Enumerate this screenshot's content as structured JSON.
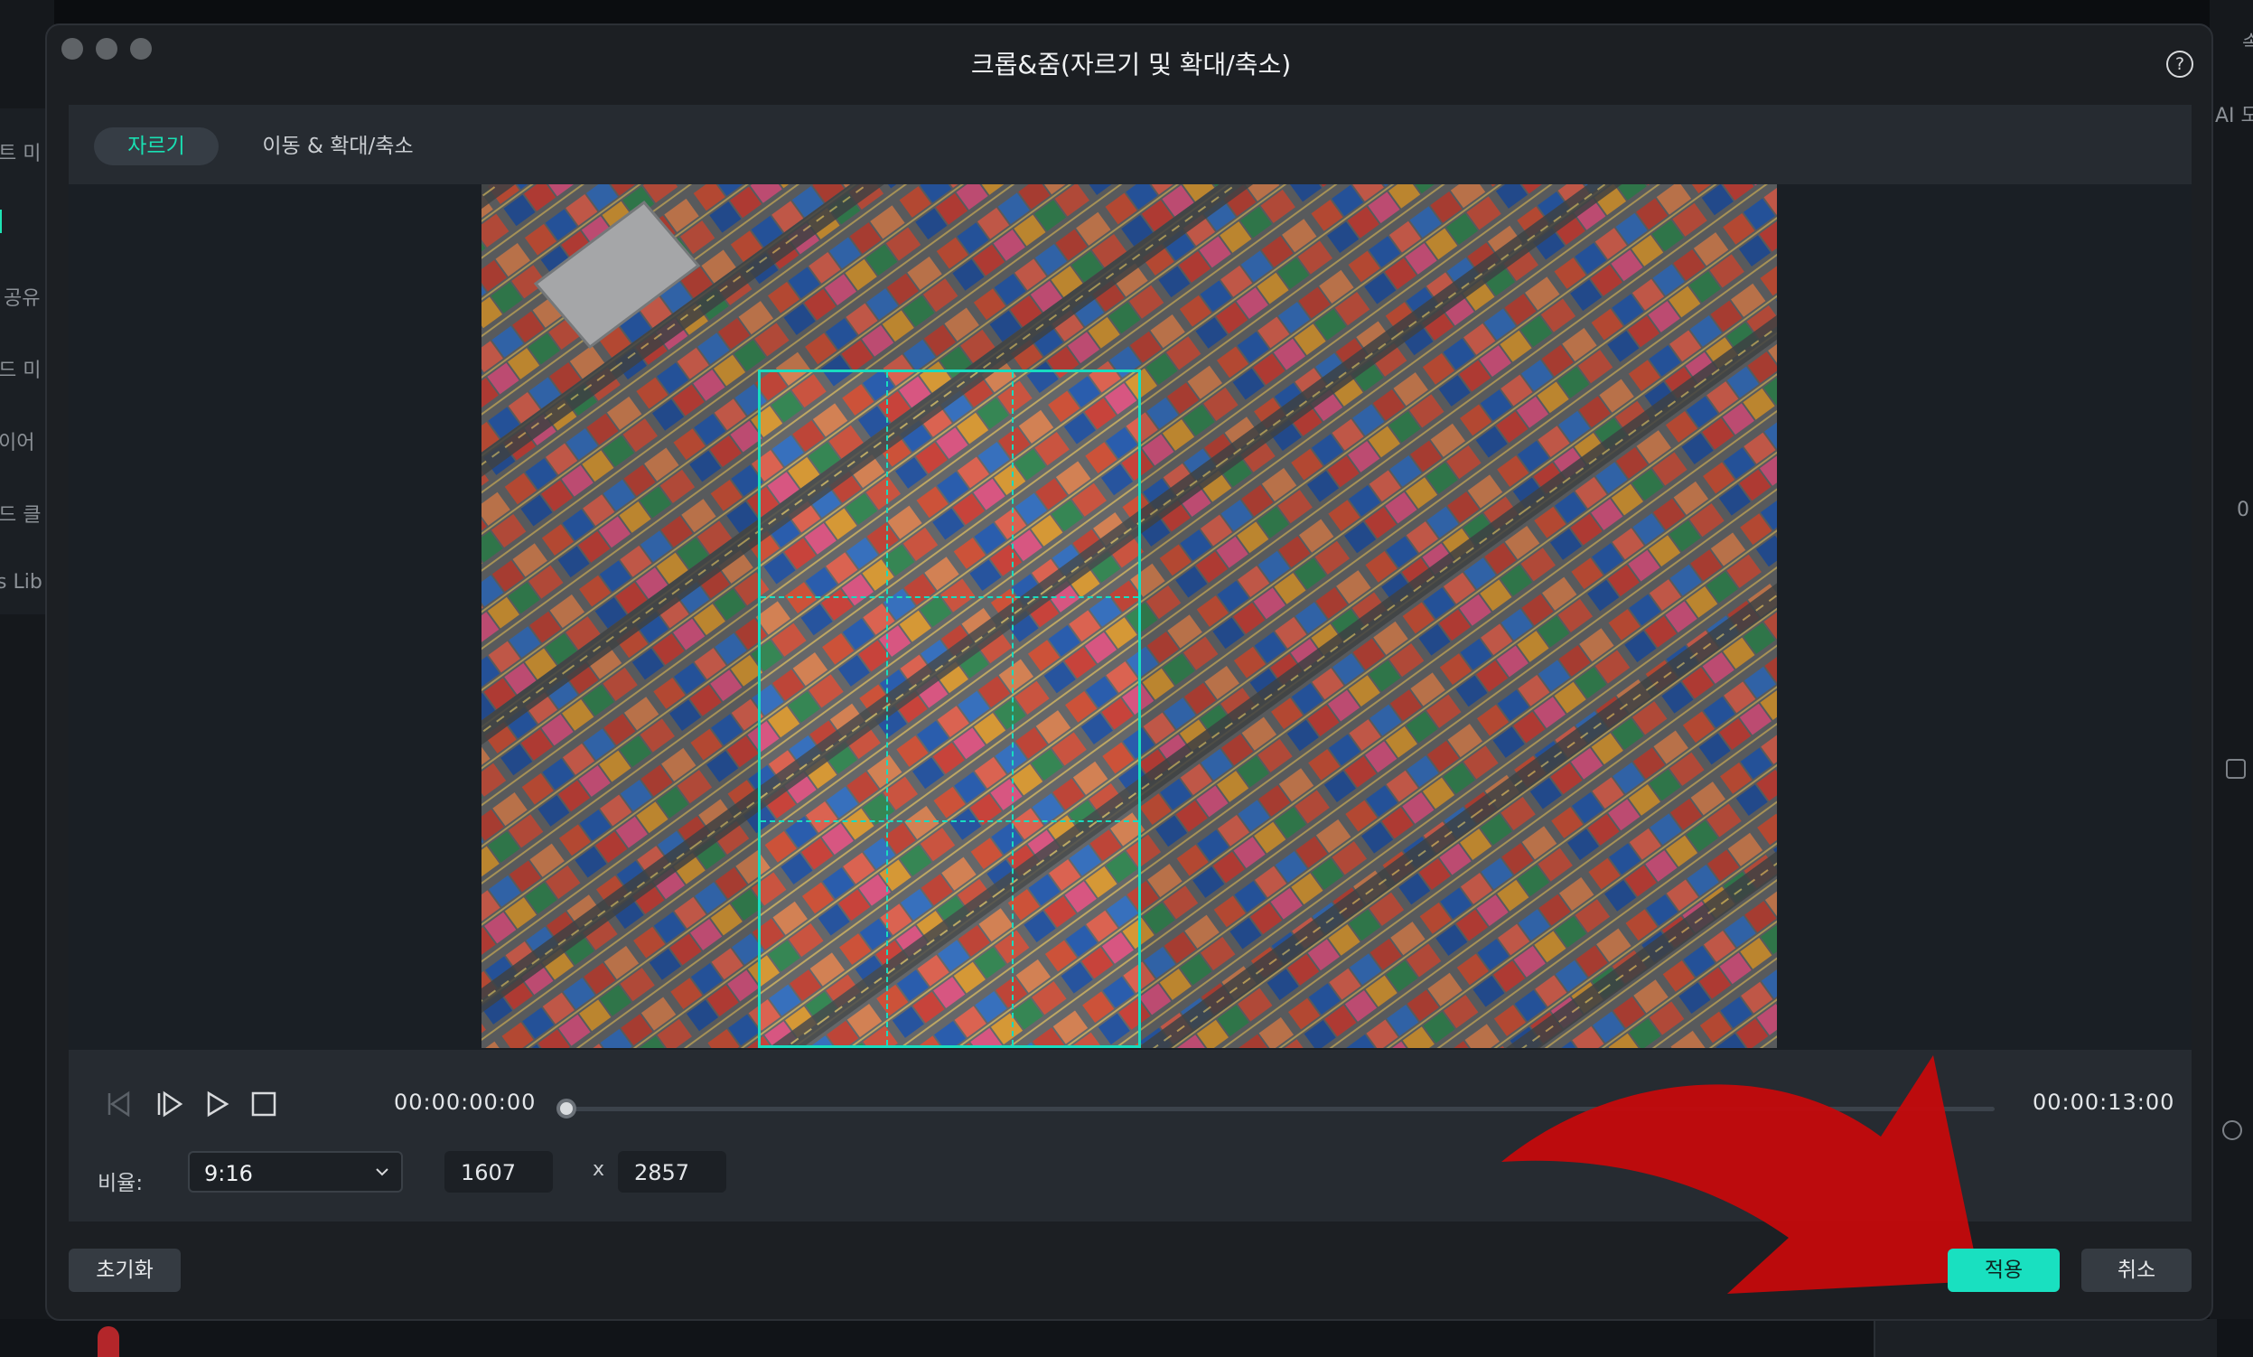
{
  "background": {
    "left_items": [
      "트 미",
      "",
      "공유",
      "드 미",
      "이어",
      "드 클",
      "s Lib"
    ],
    "right_items": [
      "속",
      "AI 도",
      "0"
    ]
  },
  "dialog": {
    "title": "크롭&줌(자르기 및 확대/축소)",
    "help_symbol": "?",
    "tabs": [
      {
        "label": "자르기",
        "active": true
      },
      {
        "label": "이동 & 확대/축소",
        "active": false
      }
    ],
    "playback": {
      "current_time": "00:00:00:00",
      "total_time": "00:00:13:00",
      "progress": 0
    },
    "ratio": {
      "label": "비율:",
      "selected": "9:16",
      "width": "1607",
      "x_symbol": "x",
      "height": "2857"
    },
    "buttons": {
      "reset": "초기화",
      "apply": "적용",
      "cancel": "취소"
    }
  },
  "colors": {
    "accent": "#19e0c0",
    "dialog_bg": "#1c1f23",
    "annotation_arrow": "#c4090c"
  },
  "icons": [
    "prev-frame-icon",
    "next-frame-icon",
    "play-icon",
    "stop-icon",
    "chevron-down-icon",
    "help-icon",
    "red-arrow-annotation-icon"
  ]
}
